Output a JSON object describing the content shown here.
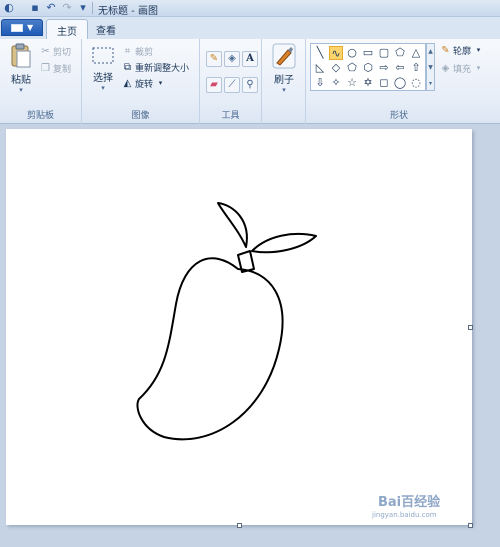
{
  "titlebar": {
    "quick_access": [
      {
        "icon": "paint-app-icon",
        "glyph": "◐"
      },
      {
        "icon": "save-icon",
        "glyph": "▪"
      },
      {
        "icon": "undo-icon",
        "glyph": "↶"
      },
      {
        "icon": "redo-icon",
        "glyph": "↷"
      },
      {
        "icon": "customize-dropdown-icon",
        "glyph": "▾"
      }
    ],
    "title": "无标题 - 画图"
  },
  "tabs": {
    "items": [
      {
        "label": "主页",
        "active": true
      },
      {
        "label": "查看",
        "active": false
      }
    ]
  },
  "ribbon": {
    "clipboard": {
      "group_label": "剪贴板",
      "paste": "粘贴",
      "cut": "剪切",
      "copy": "复制"
    },
    "image": {
      "group_label": "图像",
      "select": "选择",
      "crop": "裁剪",
      "resize": "重新调整大小",
      "rotate": "旋转"
    },
    "tools": {
      "group_label": "工具",
      "items": [
        "pencil-icon",
        "fill-bucket-icon",
        "text-icon",
        "eraser-icon",
        "color-picker-icon",
        "magnifier-icon"
      ],
      "text_glyph": "A"
    },
    "brushes": {
      "label": "刷子"
    },
    "shapes": {
      "group_label": "形状",
      "outline": "轮廓",
      "fill": "填充",
      "cells": [
        "╲",
        "∿",
        "○",
        "▭",
        "▢",
        "⬠",
        "△",
        "◺",
        "◇",
        "⬠",
        "⬡",
        "⇨",
        "⇦",
        "⇧",
        "⇩",
        "✧",
        "☆",
        "✡",
        "◻",
        "◯",
        "◌"
      ]
    }
  },
  "watermark": {
    "text": "Bai百经验",
    "url": "jingyan.baidu.com"
  }
}
